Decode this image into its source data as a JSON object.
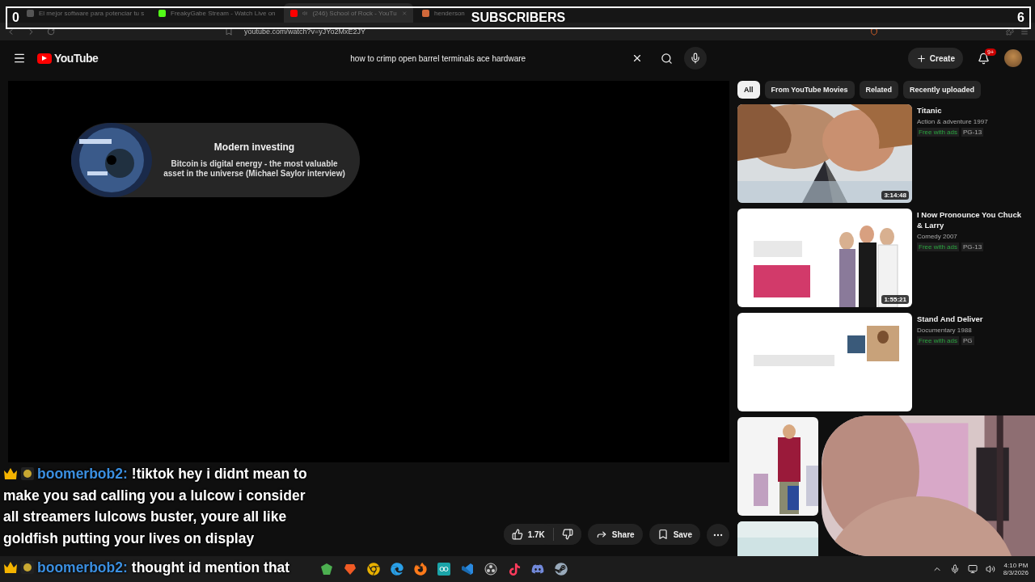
{
  "stream_overlay": {
    "left_count": "0",
    "title": "SUBSCRIBERS",
    "right_count": "6"
  },
  "browser": {
    "tabs": [
      {
        "title": "El mejor software para potenciar tu s",
        "selected": false,
        "audible": false
      },
      {
        "title": "FreakyGabe Stream - Watch Live on",
        "selected": false,
        "audible": false
      },
      {
        "title": "(246) School of Rock - YouTu",
        "selected": true,
        "audible": true
      },
      {
        "title": "henderson",
        "selected": false,
        "audible": false
      }
    ],
    "url": "youtube.com/watch?v=yJYo2MxE2JY"
  },
  "header": {
    "logo": "YouTube",
    "search": {
      "value": "how to crimp open barrel terminals ace hardware"
    },
    "create": "Create",
    "notification_badge": "9+"
  },
  "player_card": {
    "title": "Modern investing",
    "description": "Bitcoin is digital energy - the most valuable asset in the universe (Michael Saylor interview)"
  },
  "actions": {
    "likes": "1.7K",
    "share": "Share",
    "save": "Save"
  },
  "chips": [
    {
      "label": "All",
      "selected": true
    },
    {
      "label": "From YouTube Movies",
      "selected": false
    },
    {
      "label": "Related",
      "selected": false
    },
    {
      "label": "Recently uploaded",
      "selected": false
    }
  ],
  "videos": [
    {
      "title": "Titanic",
      "meta": "Action & adventure 1997",
      "badges": [
        "Free with ads",
        "PG-13"
      ],
      "duration": "3:14:48"
    },
    {
      "title": "I Now Pronounce You Chuck & Larry",
      "meta": "Comedy 2007",
      "badges": [
        "Free with ads",
        "PG-13"
      ],
      "duration": "1:55:21"
    },
    {
      "title": "Stand And Deliver",
      "meta": "Documentary 1988",
      "badges": [
        "Free with ads",
        "PG"
      ]
    }
  ],
  "chat": [
    {
      "user": "boomerbob2:",
      "lines": [
        "!tiktok hey i didnt mean to",
        "make you sad calling you a lulcow i consider",
        "all streamers lulcows buster, youre all like",
        "goldfish putting your lives on display"
      ]
    },
    {
      "user": "boomerbob2:",
      "lines": [
        "thought id mention that"
      ]
    }
  ],
  "taskbar": {
    "time": "4:10 PM",
    "date": "8/3/2026"
  }
}
